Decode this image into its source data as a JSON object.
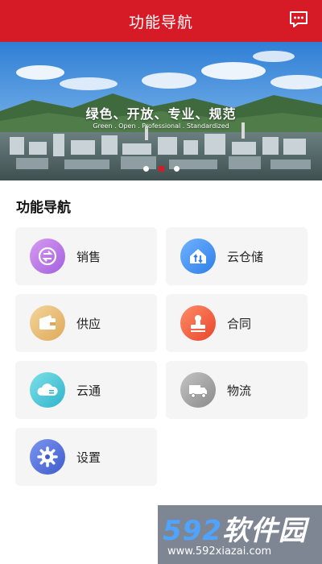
{
  "header": {
    "title": "功能导航",
    "message_icon": "message-icon"
  },
  "banner": {
    "slogan_cn": "绿色、开放、专业、规范",
    "slogan_en": "Green . Open . Professional . Standardized",
    "slides": 3,
    "active_slide": 2
  },
  "section": {
    "title": "功能导航"
  },
  "menu": [
    {
      "label": "销售",
      "icon": "sales-exchange-icon",
      "color": "#b57be8"
    },
    {
      "label": "云仓储",
      "icon": "cloud-warehouse-icon",
      "color": "#3f8ff0"
    },
    {
      "label": "供应",
      "icon": "wallet-icon",
      "color": "#e8bd6a"
    },
    {
      "label": "合同",
      "icon": "stamp-icon",
      "color": "#f05a3c"
    },
    {
      "label": "云通",
      "icon": "cloud-icon",
      "color": "#43c4d6"
    },
    {
      "label": "物流",
      "icon": "truck-icon",
      "color": "#9a9a9a"
    },
    {
      "label": "设置",
      "icon": "gear-icon",
      "color": "#4a68d8"
    }
  ],
  "watermark": {
    "brand_num": "592",
    "brand_cn": "软件园",
    "url": "www.592xiazai.com"
  },
  "colors": {
    "brand_red": "#d61b26",
    "card_bg": "#f5f5f5"
  }
}
